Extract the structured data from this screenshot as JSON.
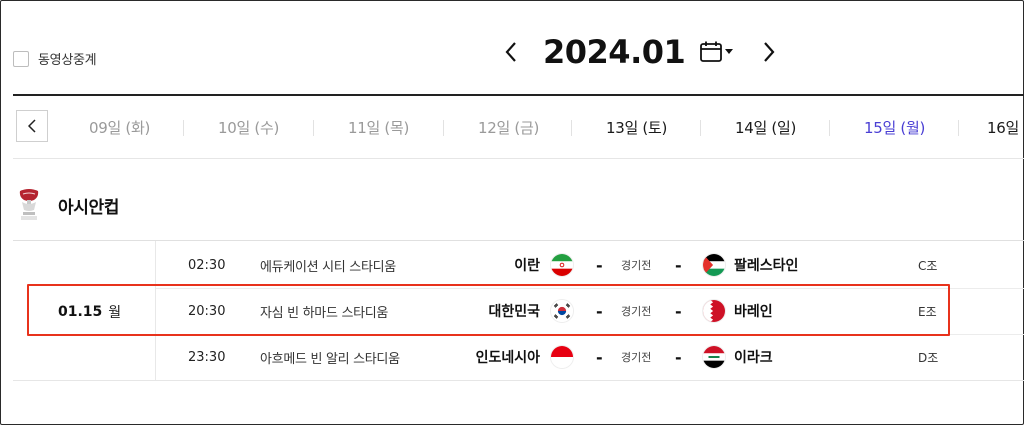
{
  "header": {
    "vod_label": "동영상중계",
    "month": "2024.01"
  },
  "days": [
    {
      "label": "09일 (화)",
      "state": "past"
    },
    {
      "label": "10일 (수)",
      "state": "past"
    },
    {
      "label": "11일 (목)",
      "state": "past"
    },
    {
      "label": "12일 (금)",
      "state": "past"
    },
    {
      "label": "13일 (토)",
      "state": "current"
    },
    {
      "label": "14일 (일)",
      "state": "current"
    },
    {
      "label": "15일 (월)",
      "state": "selected"
    },
    {
      "label": "16일",
      "state": "current"
    }
  ],
  "league": {
    "title": "아시안컵"
  },
  "date": {
    "day": "01.15",
    "weekday": "월"
  },
  "matches": [
    {
      "time": "02:30",
      "stadium": "에듀케이션 시티 스타디움",
      "home": "이란",
      "home_flag": "iran-flag-icon",
      "dash": "-",
      "status": "경기전",
      "away": "팔레스타인",
      "away_flag": "palestine-flag-icon",
      "group": "C조"
    },
    {
      "time": "20:30",
      "stadium": "자심 빈 하마드 스타디움",
      "home": "대한민국",
      "home_flag": "korea-flag-icon",
      "dash": "-",
      "status": "경기전",
      "away": "바레인",
      "away_flag": "bahrain-flag-icon",
      "group": "E조"
    },
    {
      "time": "23:30",
      "stadium": "아흐메드 빈 알리 스타디움",
      "home": "인도네시아",
      "home_flag": "indonesia-flag-icon",
      "dash": "-",
      "status": "경기전",
      "away": "이라크",
      "away_flag": "iraq-flag-icon",
      "group": "D조"
    }
  ],
  "colors": {
    "selected_day": "#4a3fd4",
    "highlight_border": "#e8321c"
  }
}
